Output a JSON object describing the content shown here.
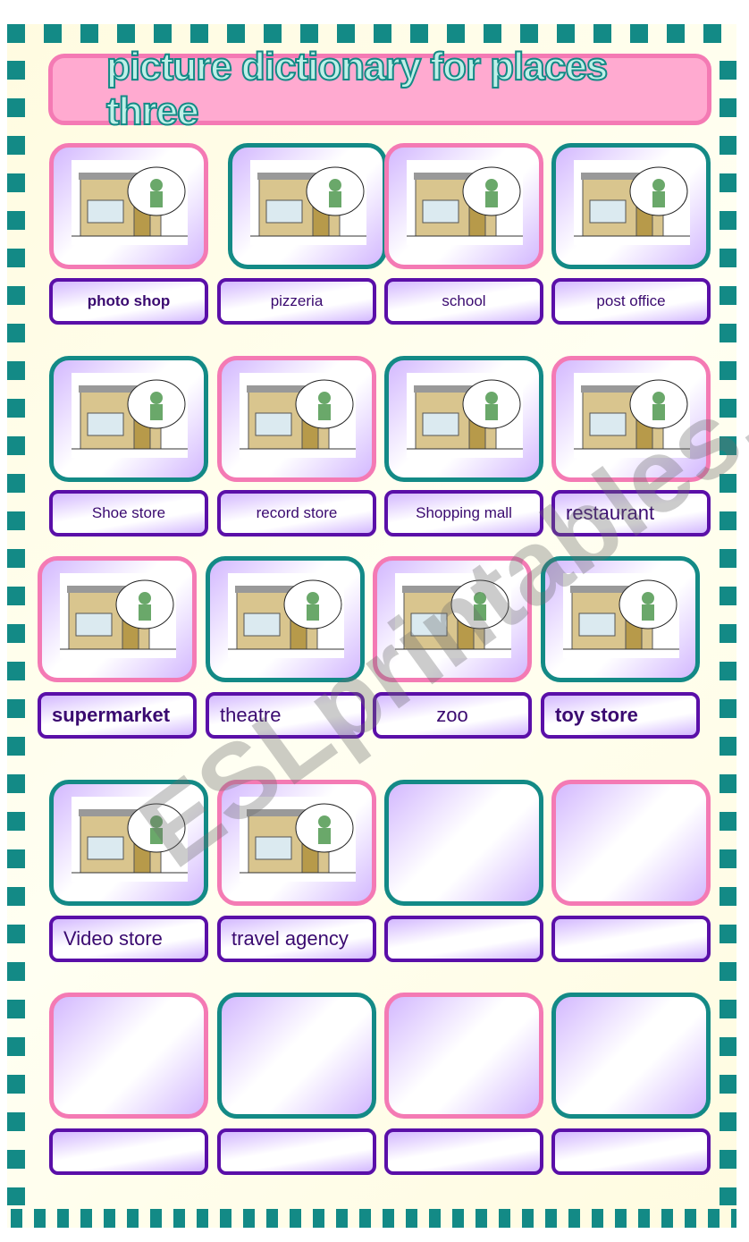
{
  "title": "picture dictionary for places three",
  "watermark": "ESLprintables.com",
  "colors": {
    "teal": "#138a86",
    "pink": "#f47ab4",
    "purple": "#5a0fa8",
    "title_bg": "#ffaad0",
    "sheet_bg": "#fffbe0"
  },
  "rows": [
    {
      "items": [
        {
          "label": "photo shop",
          "border": "pink",
          "picture": "photo-shop"
        },
        {
          "label": "pizzeria",
          "border": "teal",
          "picture": "pizzeria"
        },
        {
          "label": "school",
          "border": "pink",
          "picture": "school"
        },
        {
          "label": "post office",
          "border": "teal",
          "picture": "post-office"
        }
      ]
    },
    {
      "items": [
        {
          "label": "Shoe store",
          "border": "teal",
          "picture": "shoe-store"
        },
        {
          "label": "record store",
          "border": "pink",
          "picture": "record-store"
        },
        {
          "label": "Shopping mall",
          "border": "teal",
          "picture": "shopping-mall"
        },
        {
          "label": "restaurant",
          "border": "pink",
          "picture": "restaurant"
        }
      ]
    },
    {
      "items": [
        {
          "label": "supermarket",
          "border": "pink",
          "picture": "supermarket"
        },
        {
          "label": "theatre",
          "border": "teal",
          "picture": "theatre"
        },
        {
          "label": "zoo",
          "border": "pink",
          "picture": "zoo"
        },
        {
          "label": "toy store",
          "border": "teal",
          "picture": "toy-store"
        }
      ]
    },
    {
      "items": [
        {
          "label": "Video store",
          "border": "teal",
          "picture": "video-store"
        },
        {
          "label": "travel agency",
          "border": "pink",
          "picture": "travel-agency"
        },
        {
          "label": "",
          "border": "teal",
          "picture": ""
        },
        {
          "label": "",
          "border": "pink",
          "picture": ""
        }
      ]
    },
    {
      "items": [
        {
          "label": "",
          "border": "pink",
          "picture": ""
        },
        {
          "label": "",
          "border": "teal",
          "picture": ""
        },
        {
          "label": "",
          "border": "pink",
          "picture": ""
        },
        {
          "label": "",
          "border": "teal",
          "picture": ""
        }
      ]
    }
  ]
}
